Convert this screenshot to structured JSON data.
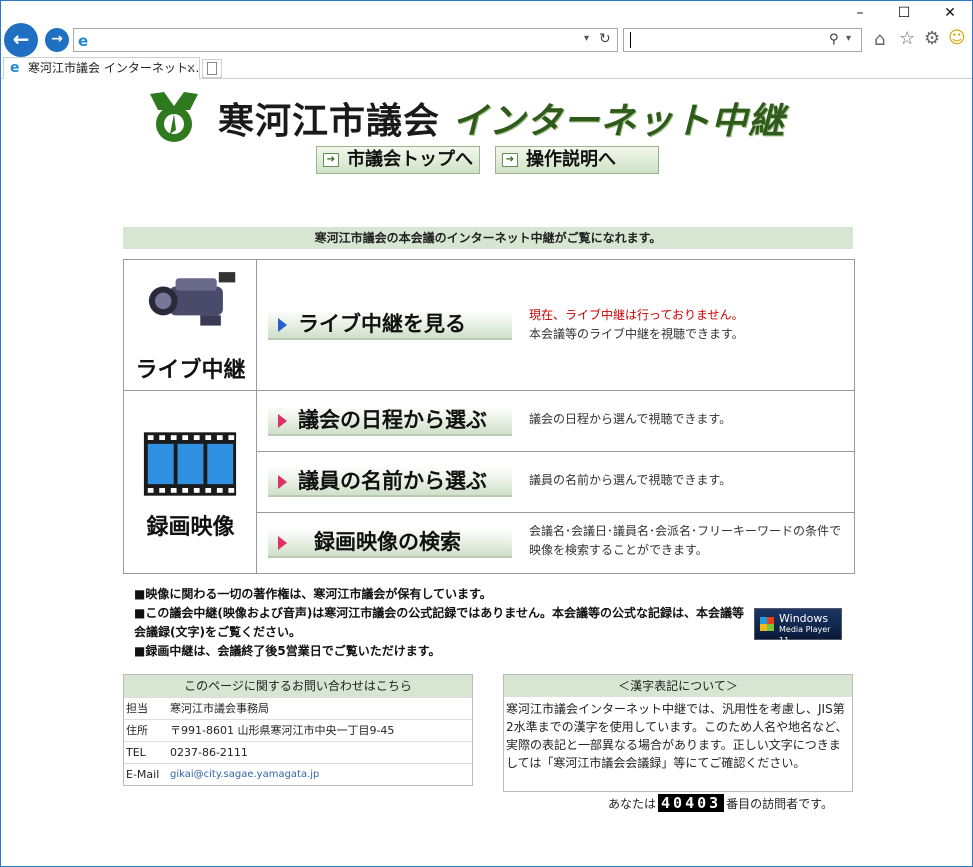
{
  "browser": {
    "tab_title": "寒河江市議会 インターネット...",
    "tab_close": "×"
  },
  "header": {
    "title_main": "寒河江市議会",
    "title_accent": "インターネット中継",
    "nav_top": "市議会トップへ",
    "nav_help": "操作説明へ"
  },
  "notice": "寒河江市議会の本会議のインターネット中継がご覧になれます。",
  "live": {
    "category": "ライブ中継",
    "button": "ライブ中継を見る",
    "status": "現在、ライブ中継は行っておりません。",
    "desc": "本会議等のライブ中継を視聴できます。"
  },
  "recorded": {
    "category": "録画映像",
    "items": [
      {
        "button": "議会の日程から選ぶ",
        "desc": "議会の日程から選んで視聴できます。"
      },
      {
        "button": "議員の名前から選ぶ",
        "desc": "議員の名前から選んで視聴できます。"
      },
      {
        "button": "録画映像の検索",
        "desc": "会議名･会議日･議員名･会派名･フリーキーワードの条件で映像を検索することができます。"
      }
    ]
  },
  "notes": [
    "■映像に関わる一切の著作権は、寒河江市議会が保有しています。",
    "■この議会中継(映像および音声)は寒河江市議会の公式記録ではありません。本会議等の公式な記録は、本会議等会議録(文字)をご覧ください。",
    "■録画中継は、会議終了後5営業日でご覧いただけます。"
  ],
  "wmp": {
    "line1": "Windows",
    "line2": "Media Player 11"
  },
  "contact": {
    "head": "このページに関するお問い合わせはこちら",
    "rows": [
      {
        "k": "担当",
        "v": "寒河江市議会事務局"
      },
      {
        "k": "住所",
        "v": "〒991-8601  山形県寒河江市中央一丁目9-45"
      },
      {
        "k": "TEL",
        "v": "0237-86-2111"
      },
      {
        "k": "E-Mail",
        "v": "gikai@city.sagae.yamagata.jp"
      }
    ]
  },
  "kanji": {
    "head": "＜漢字表記について＞",
    "body": "寒河江市議会インターネット中継では、汎用性を考慮し、JIS第2水準までの漢字を使用しています。このため人名や地名など、実際の表記と一部異なる場合があります。正しい文字につきましては「寒河江市議会会議録」等にてご確認ください。"
  },
  "counter": {
    "prefix": "あなたは",
    "value": "40403",
    "suffix": "番目の訪問者です。"
  },
  "colors": {
    "accent_green": "#2e5b1c",
    "header_bg": "#d6e6d2",
    "status_red": "#cc0000"
  }
}
